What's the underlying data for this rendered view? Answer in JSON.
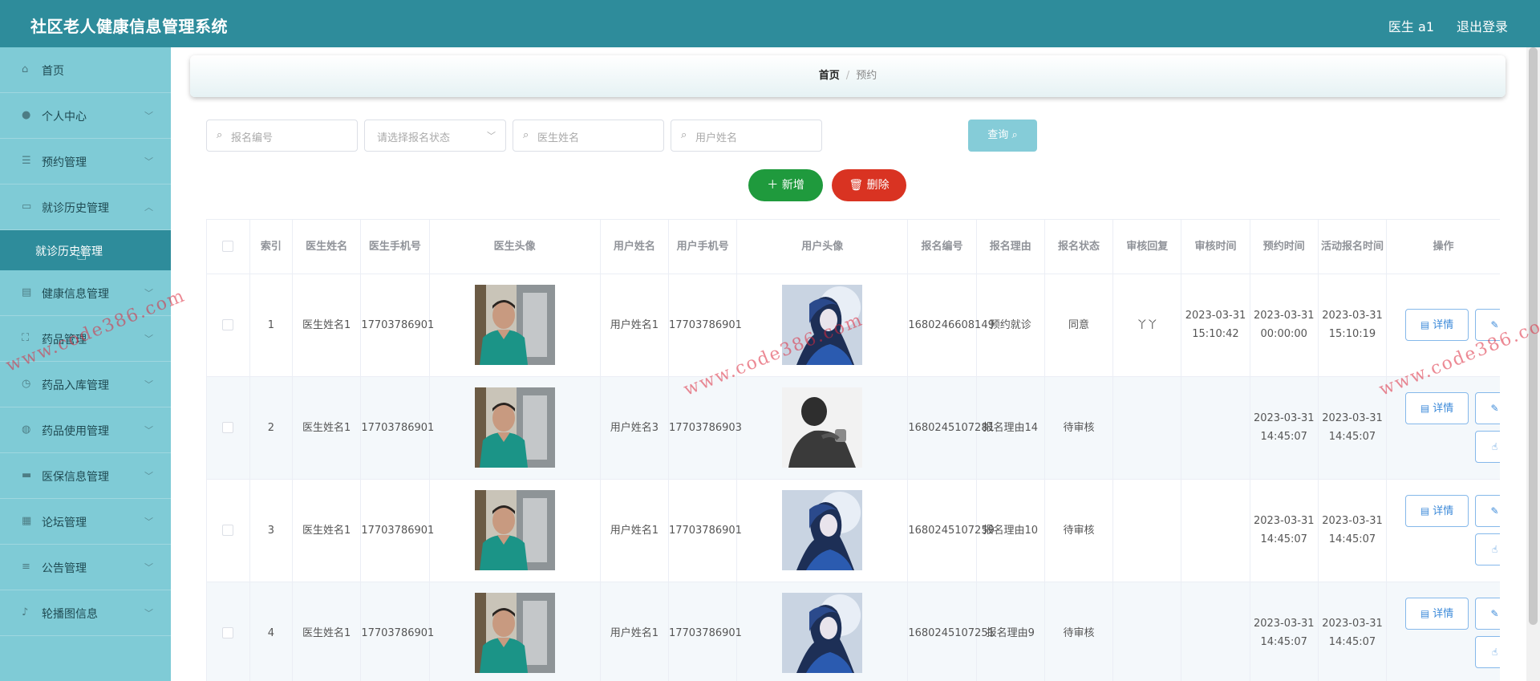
{
  "header": {
    "title": "社区老人健康信息管理系统",
    "user": "医生 a1",
    "logout": "退出登录"
  },
  "sidebar": {
    "items": [
      {
        "label": "首页",
        "icon": "home-icon",
        "glyph": "⌂",
        "has_chevron": false
      },
      {
        "label": "个人中心",
        "icon": "user-icon",
        "glyph": "●"
      },
      {
        "label": "预约管理",
        "icon": "list-icon",
        "glyph": "☰"
      },
      {
        "label": "就诊历史管理",
        "icon": "monitor-icon",
        "glyph": "▭",
        "expanded": true,
        "sub": {
          "label": "就诊历史管理"
        }
      },
      {
        "label": "健康信息管理",
        "icon": "document-icon",
        "glyph": "▤"
      },
      {
        "label": "药品管理",
        "icon": "scan-icon",
        "glyph": "⛶"
      },
      {
        "label": "药品入库管理",
        "icon": "clock-icon",
        "glyph": "◷"
      },
      {
        "label": "药品使用管理",
        "icon": "globe-icon",
        "glyph": "◍"
      },
      {
        "label": "医保信息管理",
        "icon": "monitor-icon",
        "glyph": "▬"
      },
      {
        "label": "论坛管理",
        "icon": "grid-icon",
        "glyph": "▦"
      },
      {
        "label": "公告管理",
        "icon": "sliders-icon",
        "glyph": "≡"
      },
      {
        "label": "轮播图信息",
        "icon": "microphone-icon",
        "glyph": "♪"
      }
    ]
  },
  "breadcrumb": {
    "home": "首页",
    "sep": "/",
    "current": "预约"
  },
  "search": {
    "reg_no": "报名编号",
    "status": "请选择报名状态",
    "doctor": "医生姓名",
    "user": "用户姓名",
    "query": "查询"
  },
  "actions": {
    "add": "新增",
    "delete": "删除"
  },
  "table": {
    "headers": [
      "索引",
      "医生姓名",
      "医生手机号",
      "医生头像",
      "用户姓名",
      "用户手机号",
      "用户头像",
      "报名编号",
      "报名理由",
      "报名状态",
      "审核回复",
      "审核时间",
      "预约时间",
      "活动报名时间",
      "操作"
    ],
    "buttons": {
      "detail": "详情",
      "edit": "修改",
      "audit": "审核"
    },
    "rows": [
      {
        "index": "1",
        "doctor": "医生姓名1",
        "doctor_phone": "17703786901",
        "user": "用户姓名1",
        "user_phone": "17703786901",
        "reg_no": "1680246608149",
        "reason": "预约就诊",
        "status": "同意",
        "reply": "丫丫",
        "audit_time": "2023-03-31 15:10:42",
        "appoint_time": "2023-03-31 00:00:00",
        "reg_time": "2023-03-31 15:10:19",
        "user_avatar": "blue",
        "show_audit": false
      },
      {
        "index": "2",
        "doctor": "医生姓名1",
        "doctor_phone": "17703786901",
        "user": "用户姓名3",
        "user_phone": "17703786903",
        "reg_no": "1680245107281",
        "reason": "报名理由14",
        "status": "待审核",
        "reply": "",
        "audit_time": "",
        "appoint_time": "2023-03-31 14:45:07",
        "reg_time": "2023-03-31 14:45:07",
        "user_avatar": "gray",
        "show_audit": true
      },
      {
        "index": "3",
        "doctor": "医生姓名1",
        "doctor_phone": "17703786901",
        "user": "用户姓名1",
        "user_phone": "17703786901",
        "reg_no": "1680245107259",
        "reason": "报名理由10",
        "status": "待审核",
        "reply": "",
        "audit_time": "",
        "appoint_time": "2023-03-31 14:45:07",
        "reg_time": "2023-03-31 14:45:07",
        "user_avatar": "blue",
        "show_audit": true
      },
      {
        "index": "4",
        "doctor": "医生姓名1",
        "doctor_phone": "17703786901",
        "user": "用户姓名1",
        "user_phone": "17703786901",
        "reg_no": "1680245107251",
        "reason": "报名理由9",
        "status": "待审核",
        "reply": "",
        "audit_time": "",
        "appoint_time": "2023-03-31 14:45:07",
        "reg_time": "2023-03-31 14:45:07",
        "user_avatar": "blue",
        "show_audit": true
      }
    ]
  },
  "watermark": "www.code386.com",
  "colors": {
    "header": "#2e8c9b",
    "sidebar": "#7fcbd6",
    "active": "#2e8c9b",
    "add": "#1f9a3d",
    "delete": "#d93322",
    "query": "#85ccd8",
    "link": "#3c8ad9"
  }
}
